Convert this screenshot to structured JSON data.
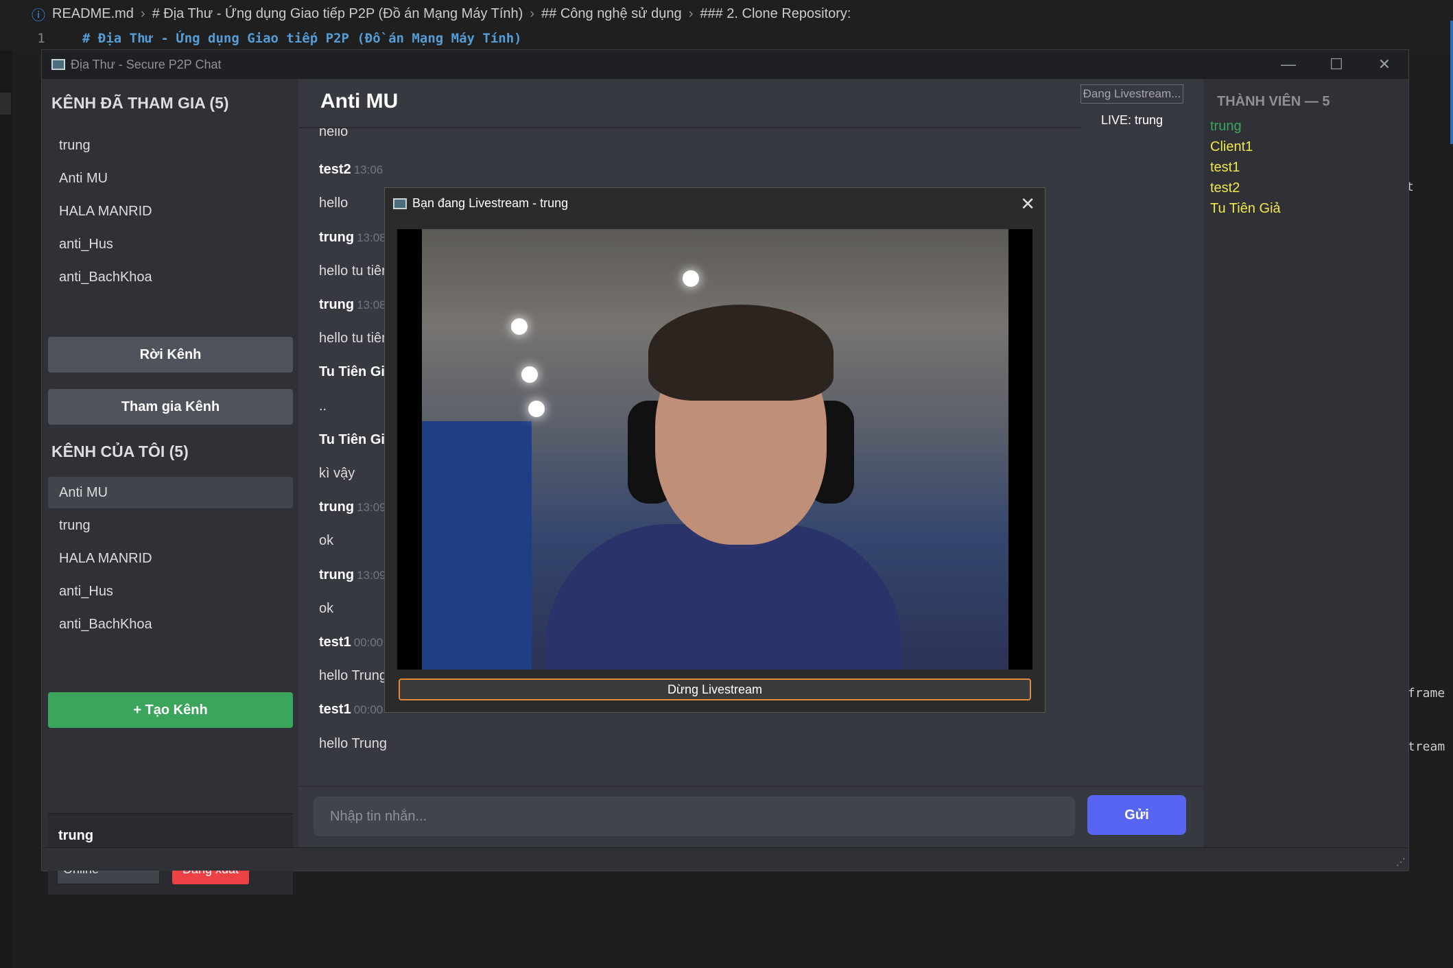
{
  "editor": {
    "breadcrumb": [
      "README.md",
      "# Địa Thư - Ứng dụng Giao tiếp P2P (Đồ án Mạng Máy Tính)",
      "## Công nghệ sử dụng",
      "### 2. Clone Repository:"
    ],
    "line_number": "1",
    "line_text": "# Địa Thư - Ứng dụng Giao tiếp P2P (Đồ án Mạng Máy Tính)",
    "fragments": [
      "t",
      "frame",
      "tream"
    ]
  },
  "window": {
    "title": "Địa Thư - Secure P2P Chat",
    "minimize": "—",
    "maximize": "☐",
    "close": "✕"
  },
  "sidebar": {
    "joined_header": "KÊNH ĐÃ THAM GIA (5)",
    "joined": [
      "trung",
      "Anti MU",
      "HALA MANRID",
      "anti_Hus",
      "anti_BachKhoa"
    ],
    "leave_button": "Rời Kênh",
    "join_button": "Tham gia Kênh",
    "mine_header": "KÊNH CỦA TÔI (5)",
    "mine": [
      "Anti MU",
      "trung",
      "HALA MANRID",
      "anti_Hus",
      "anti_BachKhoa"
    ],
    "create_button": "+ Tạo Kênh",
    "user": {
      "name": "trung",
      "status": "Online",
      "logout": "Đăng xuất"
    }
  },
  "chat": {
    "title": "Anti MU",
    "live_status": "Đang Livestream...",
    "live_label": "LIVE: trung",
    "messages": [
      {
        "type": "text",
        "text": "hello"
      },
      {
        "type": "head",
        "author": "test2",
        "time": "13:06"
      },
      {
        "type": "text",
        "text": "hello"
      },
      {
        "type": "head",
        "author": "trung",
        "time": "13:08"
      },
      {
        "type": "text",
        "text": "hello tu tiên"
      },
      {
        "type": "head",
        "author": "trung",
        "time": "13:08"
      },
      {
        "type": "text",
        "text": "hello tu tiên"
      },
      {
        "type": "head",
        "author": "Tu Tiên Giả",
        "time": ""
      },
      {
        "type": "text",
        "text": ".."
      },
      {
        "type": "head",
        "author": "Tu Tiên Giả",
        "time": ""
      },
      {
        "type": "text",
        "text": "kì vậy"
      },
      {
        "type": "head",
        "author": "trung",
        "time": "13:09"
      },
      {
        "type": "text",
        "text": "ok"
      },
      {
        "type": "head",
        "author": "trung",
        "time": "13:09"
      },
      {
        "type": "text",
        "text": "ok"
      },
      {
        "type": "head",
        "author": "test1",
        "time": "00:00"
      },
      {
        "type": "text",
        "text": "hello Trung"
      },
      {
        "type": "head",
        "author": "test1",
        "time": "00:00"
      },
      {
        "type": "text",
        "text": "hello Trung"
      }
    ],
    "input_placeholder": "Nhập tin nhắn...",
    "send_button": "Gửi"
  },
  "members": {
    "header": "THÀNH VIÊN — 5",
    "list": [
      {
        "name": "trung",
        "color": "#3ba55c"
      },
      {
        "name": "Client1",
        "color": "#f1e74a"
      },
      {
        "name": "test1",
        "color": "#f1e74a"
      },
      {
        "name": "test2",
        "color": "#f1e74a"
      },
      {
        "name": "Tu Tiên Giả",
        "color": "#f1e74a"
      }
    ]
  },
  "livestream_dialog": {
    "title": "Bạn đang Livestream - trung",
    "close": "✕",
    "stop_button": "Dừng Livestream"
  }
}
